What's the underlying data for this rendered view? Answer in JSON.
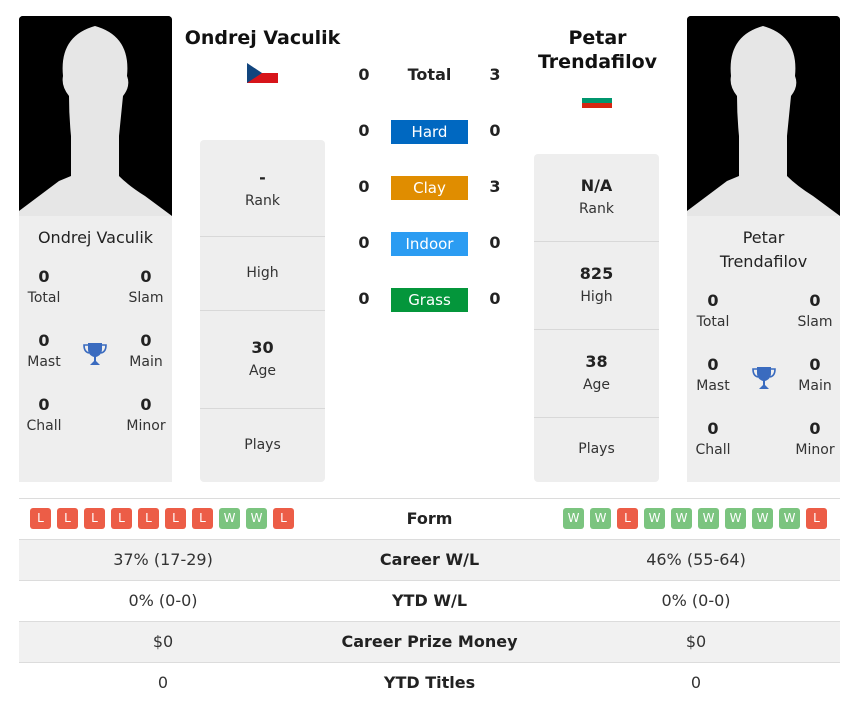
{
  "colors": {
    "hard": "#0068c1",
    "clay": "#e08d00",
    "indoor": "#2b9cf2",
    "grass": "#04963b",
    "win": "#7bc47f",
    "loss": "#ec5d47",
    "trophy": "#3a6bbf"
  },
  "player1": {
    "name": "Ondrej Vaculik",
    "card_name": "Ondrej Vaculik",
    "flag": "czech-republic",
    "titles": {
      "total": "0",
      "total_label": "Total",
      "slam": "0",
      "slam_label": "Slam",
      "mast": "0",
      "mast_label": "Mast",
      "main": "0",
      "main_label": "Main",
      "chall": "0",
      "chall_label": "Chall",
      "minor": "0",
      "minor_label": "Minor"
    },
    "rank": "-",
    "rank_label": "Rank",
    "high": "",
    "high_label": "High",
    "age": "30",
    "age_label": "Age",
    "plays": "",
    "plays_label": "Plays",
    "form": [
      "L",
      "L",
      "L",
      "L",
      "L",
      "L",
      "L",
      "W",
      "W",
      "L"
    ]
  },
  "player2": {
    "name_line1": "Petar",
    "name_line2": "Trendafilov",
    "card_name_line1": "Petar",
    "card_name_line2": "Trendafilov",
    "flag": "bulgaria",
    "titles": {
      "total": "0",
      "total_label": "Total",
      "slam": "0",
      "slam_label": "Slam",
      "mast": "0",
      "mast_label": "Mast",
      "main": "0",
      "main_label": "Main",
      "chall": "0",
      "chall_label": "Chall",
      "minor": "0",
      "minor_label": "Minor"
    },
    "rank": "N/A",
    "rank_label": "Rank",
    "high": "825",
    "high_label": "High",
    "age": "38",
    "age_label": "Age",
    "plays": "",
    "plays_label": "Plays",
    "form": [
      "W",
      "W",
      "L",
      "W",
      "W",
      "W",
      "W",
      "W",
      "W",
      "L"
    ]
  },
  "h2h": {
    "total": {
      "label": "Total",
      "p1": "0",
      "p2": "3"
    },
    "hard": {
      "label": "Hard",
      "p1": "0",
      "p2": "0"
    },
    "clay": {
      "label": "Clay",
      "p1": "0",
      "p2": "3"
    },
    "indoor": {
      "label": "Indoor",
      "p1": "0",
      "p2": "0"
    },
    "grass": {
      "label": "Grass",
      "p1": "0",
      "p2": "0"
    }
  },
  "comparison": {
    "form_label": "Form",
    "rows": [
      {
        "label": "Career W/L",
        "p1": "37% (17-29)",
        "p2": "46% (55-64)"
      },
      {
        "label": "YTD W/L",
        "p1": "0% (0-0)",
        "p2": "0% (0-0)"
      },
      {
        "label": "Career Prize Money",
        "p1": "$0",
        "p2": "$0"
      },
      {
        "label": "YTD Titles",
        "p1": "0",
        "p2": "0"
      }
    ]
  }
}
